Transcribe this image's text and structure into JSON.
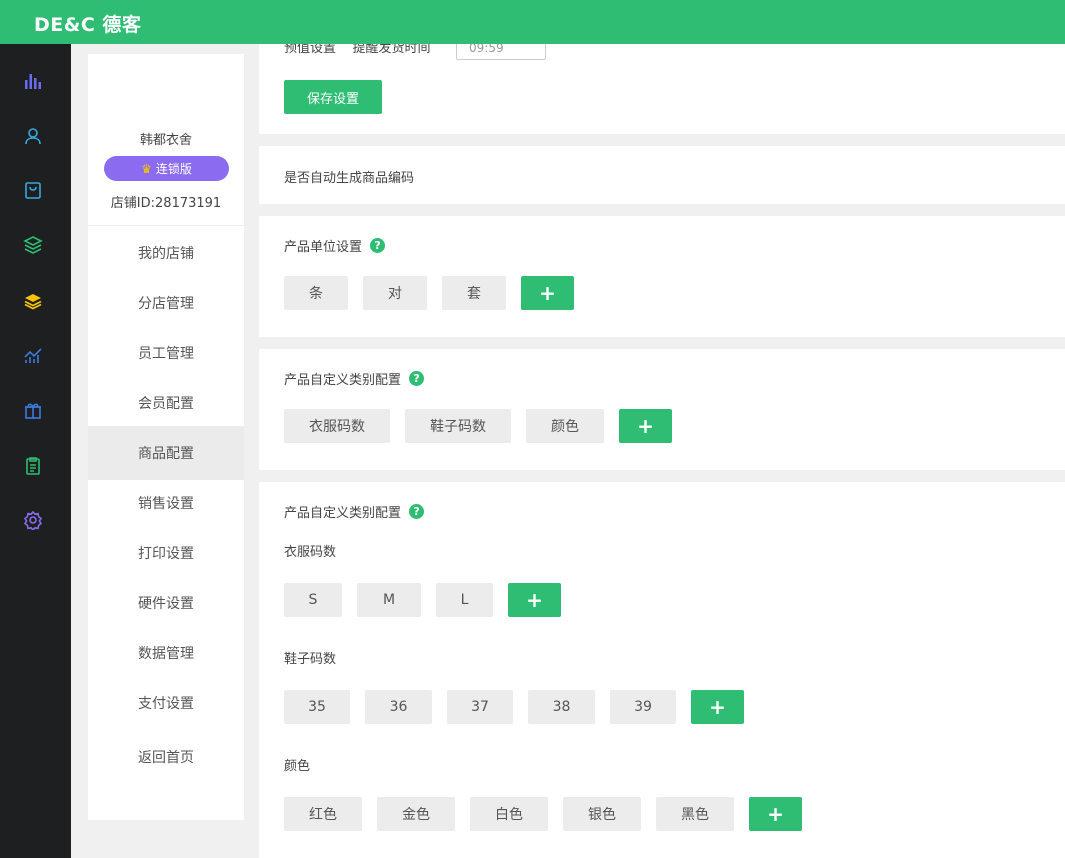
{
  "app": {
    "logo_text": "DE&C 德客"
  },
  "rail_icons": [
    "bar-chart-icon",
    "user-icon",
    "shopping-bag-icon",
    "layers-icon",
    "stack-icon",
    "trend-chart-icon",
    "gift-icon",
    "clipboard-icon",
    "settings-icon"
  ],
  "store": {
    "name": "韩都衣舍",
    "plan": "连锁版",
    "store_id": "店铺ID:28173191"
  },
  "nav": {
    "items": [
      "我的店铺",
      "分店管理",
      "员工管理",
      "会员配置",
      "商品配置",
      "销售设置",
      "打印设置",
      "硬件设置",
      "数据管理",
      "支付设置"
    ],
    "active": "商品配置",
    "back": "返回首页"
  },
  "top_section": {
    "label": "预值设置",
    "reminder_label": "提醒发货时间",
    "time_value": "09:59",
    "save_label": "保存设置"
  },
  "auto_code": {
    "label": "是否自动生成商品编码"
  },
  "unit_settings": {
    "label": "产品单位设置",
    "help": "?",
    "units": [
      "条",
      "对",
      "套"
    ],
    "add": "+"
  },
  "custom_category": {
    "label": "产品自定义类别配置",
    "help": "?",
    "categories": [
      "衣服码数",
      "鞋子码数",
      "颜色"
    ],
    "add": "+"
  },
  "custom_category_detail": {
    "label": "产品自定义类别配置",
    "help": "?",
    "groups": [
      {
        "name": "衣服码数",
        "values": [
          "S",
          "M",
          "L"
        ],
        "add": "+"
      },
      {
        "name": "鞋子码数",
        "values": [
          "35",
          "36",
          "37",
          "38",
          "39"
        ],
        "add": "+"
      },
      {
        "name": "颜色",
        "values": [
          "红色",
          "金色",
          "白色",
          "银色",
          "黑色"
        ],
        "add": "+"
      }
    ]
  },
  "colors": {
    "brand_green": "#2ebd73",
    "badge_purple": "#8b6cf0",
    "rail_bg": "#1e1f21"
  }
}
